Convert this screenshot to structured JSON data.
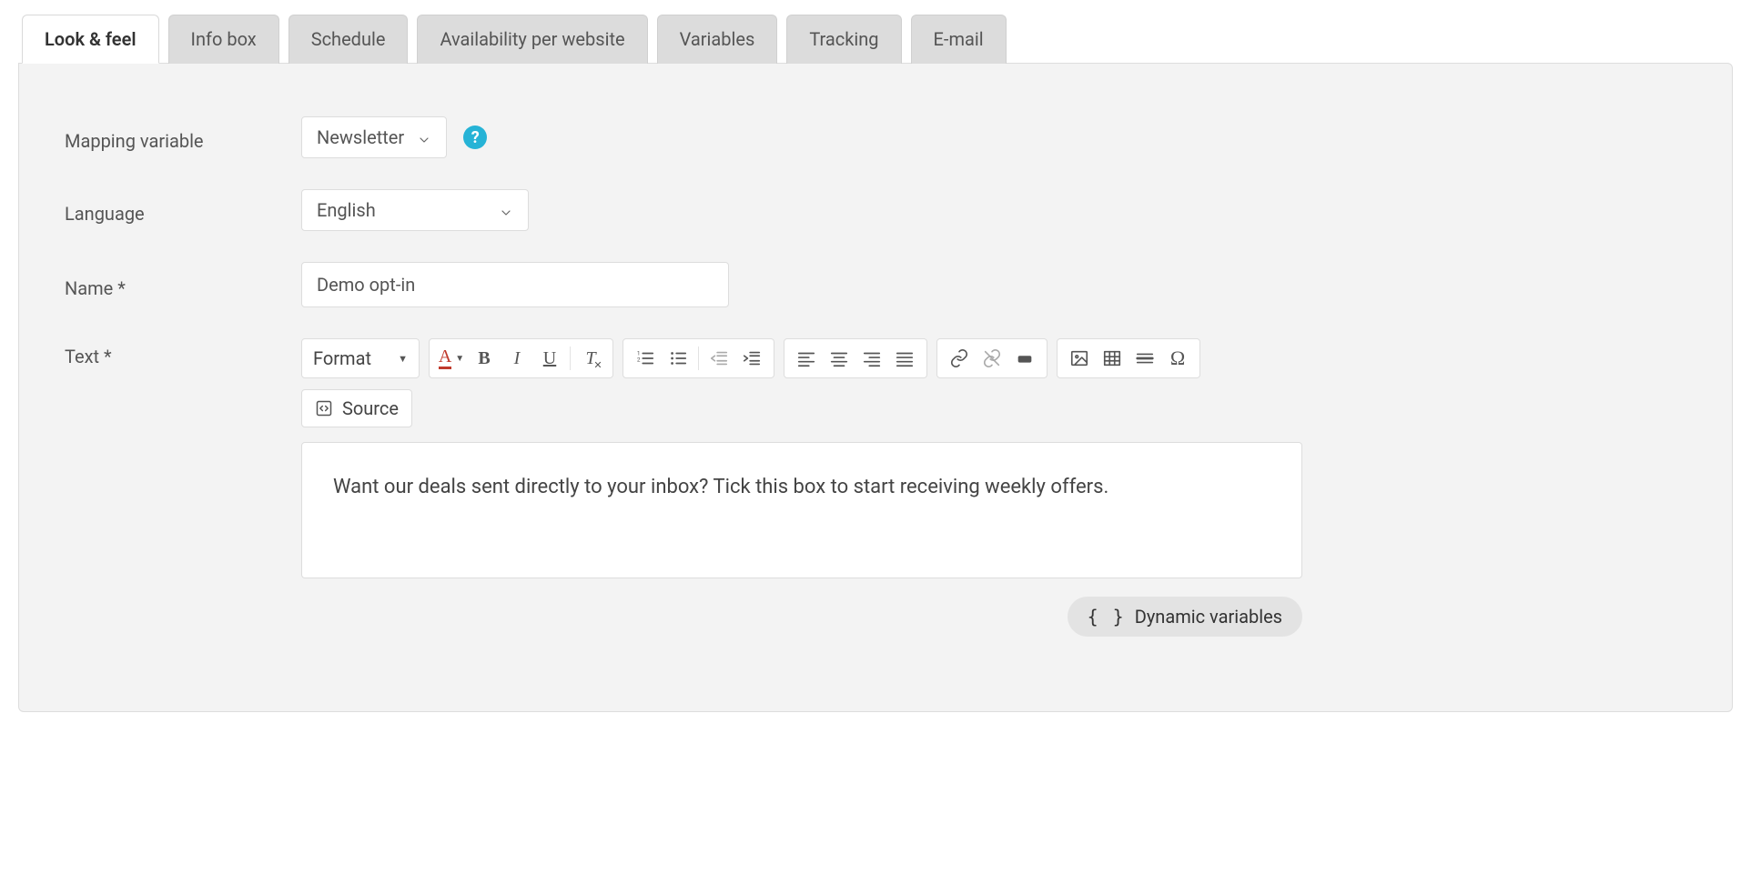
{
  "tabs": [
    {
      "label": "Look & feel",
      "active": true
    },
    {
      "label": "Info box"
    },
    {
      "label": "Schedule"
    },
    {
      "label": "Availability per website"
    },
    {
      "label": "Variables"
    },
    {
      "label": "Tracking"
    },
    {
      "label": "E-mail"
    }
  ],
  "form": {
    "mapping_variable_label": "Mapping variable",
    "mapping_variable_value": "Newsletter",
    "help_badge": "?",
    "language_label": "Language",
    "language_value": "English",
    "name_label": "Name *",
    "name_value": "Demo opt-in",
    "text_label": "Text *"
  },
  "toolbar": {
    "format_label": "Format",
    "source_label": "Source"
  },
  "editor": {
    "content": "Want our deals sent directly to your inbox? Tick this box to start receiving weekly offers."
  },
  "dynamic_variables_label": "Dynamic variables"
}
